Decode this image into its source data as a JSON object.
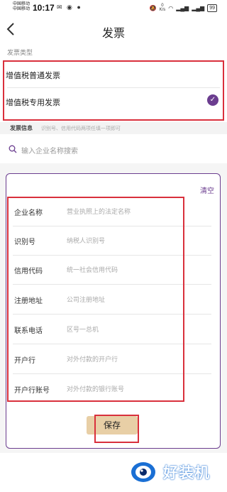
{
  "status_bar": {
    "carrier_1": "中国移动",
    "carrier_2": "中国移动",
    "time": "10:17",
    "left_icons": "✉ ◉ ●",
    "speed_value": "0",
    "speed_unit": "K/s",
    "battery": "99"
  },
  "header": {
    "title": "发票"
  },
  "invoice_type": {
    "section_label": "发票类型",
    "options": [
      {
        "label": "增值税普通发票",
        "selected": false
      },
      {
        "label": "增值税专用发票",
        "selected": true
      }
    ]
  },
  "invoice_info": {
    "label": "发票信息",
    "hint": "识别号、信用代码两项任填一项即可"
  },
  "search": {
    "placeholder": "输入企业名称搜索"
  },
  "form": {
    "clear_label": "清空",
    "rows": [
      {
        "label": "企业名称",
        "placeholder": "营业执照上的法定名称"
      },
      {
        "label": "识别号",
        "placeholder": "纳税人识别号"
      },
      {
        "label": "信用代码",
        "placeholder": "统一社会信用代码"
      },
      {
        "label": "注册地址",
        "placeholder": "公司注册地址"
      },
      {
        "label": "联系电话",
        "placeholder": "区号一总机"
      },
      {
        "label": "开户行",
        "placeholder": "对外付款的开户行"
      },
      {
        "label": "开户行账号",
        "placeholder": "对外付款的银行账号"
      }
    ],
    "save_label": "保存"
  },
  "watermark": {
    "text": "好装机"
  },
  "colors": {
    "accent": "#6b3d8f",
    "highlight_box": "#d9303c",
    "save_button": "#e8cfa6"
  }
}
